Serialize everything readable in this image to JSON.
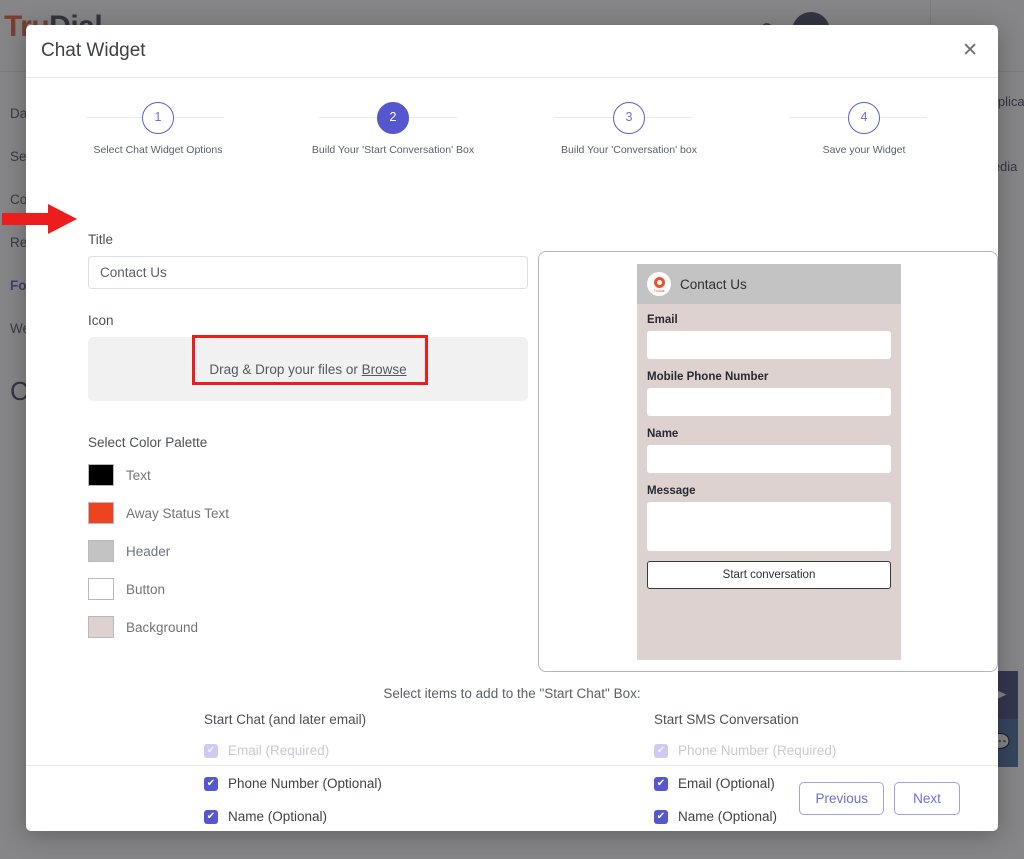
{
  "background": {
    "logo_text": "Tru",
    "logo_text_dark": "Dial",
    "sidebar_items": [
      {
        "label": "Dashboard"
      },
      {
        "label": "Send Message"
      },
      {
        "label": "Contacts"
      },
      {
        "label": "Reports"
      },
      {
        "label": "Forms"
      },
      {
        "label": "Website"
      },
      {
        "label": "Chat"
      }
    ],
    "right_panel": {
      "line1": "Application",
      "line2": "Media"
    },
    "topbar": {
      "mail_icon": "mail-icon",
      "search_icon": "search-icon",
      "avatar": "avatar"
    },
    "fabs": [
      {
        "name": "send-icon",
        "glyph": "➤"
      },
      {
        "name": "chat-bubble-icon",
        "glyph": "▬"
      }
    ]
  },
  "modal": {
    "title": "Chat Widget",
    "close_label": "✕",
    "stepper": [
      {
        "number": "1",
        "label": "Select Chat Widget Options",
        "state": "pending"
      },
      {
        "number": "2",
        "label": "Build Your 'Start Conversation' Box",
        "state": "current"
      },
      {
        "number": "3",
        "label": "Build Your 'Conversation' box",
        "state": "pending"
      },
      {
        "number": "4",
        "label": "Save your Widget",
        "state": "pending"
      }
    ],
    "form": {
      "title_label": "Title",
      "title_value": "Contact Us",
      "title_placeholder": "Contact Us",
      "icon_label": "Icon",
      "dropzone_prefix": "Drag & Drop your files or ",
      "dropzone_link": "Browse",
      "palette_label": "Select Color Palette",
      "palette": [
        {
          "label": "Text",
          "color": "#000000"
        },
        {
          "label": "Away Status Text",
          "color": "#ed4320"
        },
        {
          "label": "Header",
          "color": "#c3c3c3"
        },
        {
          "label": "Button",
          "color": "#ffffff"
        },
        {
          "label": "Background",
          "color": "#ded2d0"
        }
      ]
    },
    "preview": {
      "widget_title": "Contact Us",
      "logo_name": "trudial-logo-icon",
      "logo_text": "TruDial",
      "fields": [
        {
          "label": "Email",
          "type": "input"
        },
        {
          "label": "Mobile Phone Number",
          "type": "input"
        },
        {
          "label": "Name",
          "type": "input"
        },
        {
          "label": "Message",
          "type": "textarea"
        }
      ],
      "button_label": "Start conversation"
    },
    "checkbox_section": {
      "heading": "Select items to add to the \"Start Chat\" Box:",
      "columns": [
        {
          "title": "Start Chat (and later email)",
          "items": [
            {
              "label": "Email (Required)",
              "checked": true,
              "disabled": true
            },
            {
              "label": "Phone Number (Optional)",
              "checked": true,
              "disabled": false
            },
            {
              "label": "Name (Optional)",
              "checked": true,
              "disabled": false
            }
          ]
        },
        {
          "title": "Start SMS Conversation",
          "items": [
            {
              "label": "Phone Number (Required)",
              "checked": true,
              "disabled": true
            },
            {
              "label": "Email (Optional)",
              "checked": true,
              "disabled": false
            },
            {
              "label": "Name (Optional)",
              "checked": true,
              "disabled": false
            }
          ]
        }
      ],
      "check_glyph": "✔"
    },
    "footer": {
      "previous_label": "Previous",
      "next_label": "Next"
    }
  },
  "annotations": {
    "arrow_color": "#ee1d1d",
    "highlight_box_color": "#ee1d1d"
  }
}
